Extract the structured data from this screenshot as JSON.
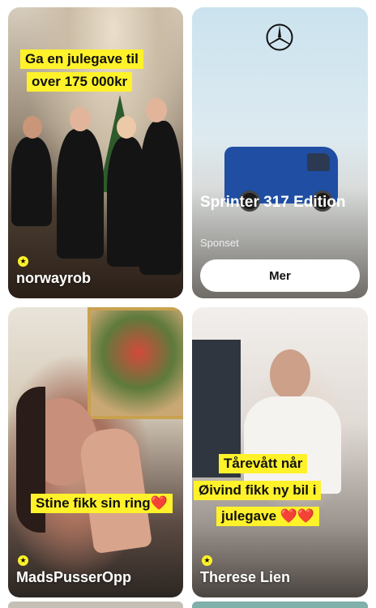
{
  "cards": [
    {
      "caption_lines": [
        "Ga en julegave til",
        "over 175 000kr"
      ],
      "creator": "norwayrob"
    },
    {
      "ad_title": "Sprinter 317 Edition",
      "ad_subtitle": "Sponset",
      "button_label": "Mer"
    },
    {
      "caption_lines": [
        "Stine fikk sin ring❤️"
      ],
      "creator": "MadsPusserOpp"
    },
    {
      "caption_lines": [
        "Tårevått når",
        "Øivind fikk ny bil i",
        "julegave ❤️❤️"
      ],
      "creator": "Therese Lien"
    }
  ],
  "colors": {
    "caption_bg": "#fff22a",
    "van": "#1f4ea3"
  },
  "icons": [
    "star-badge-icon",
    "mercedes-logo-icon"
  ]
}
